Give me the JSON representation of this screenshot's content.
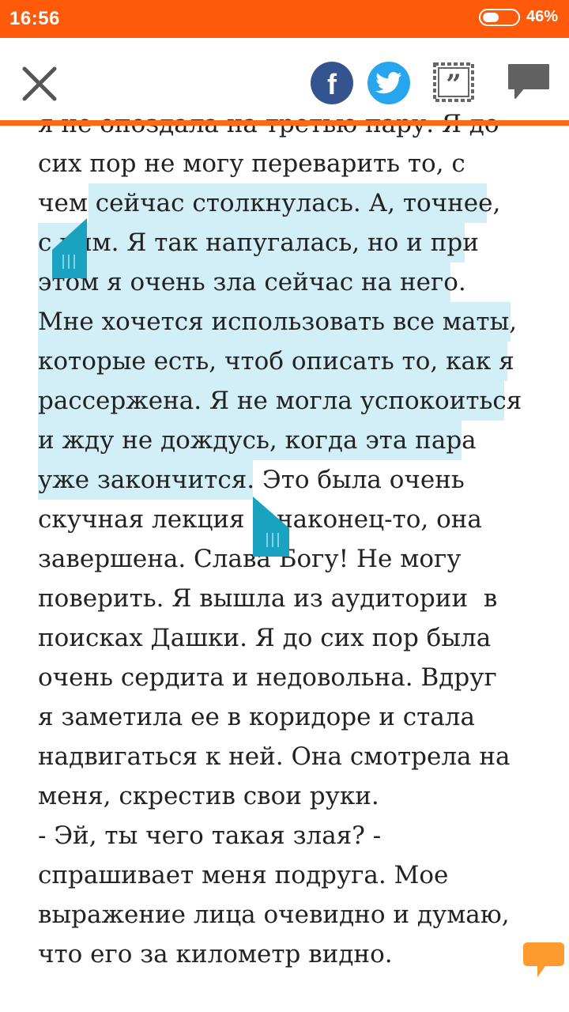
{
  "status_bar": {
    "time": "16:56",
    "battery": "46%"
  },
  "toolbar": {
    "close_icon": "close-icon",
    "facebook_icon": "facebook-icon",
    "facebook_glyph": "f",
    "twitter_icon": "twitter-icon",
    "quote_icon": "quote-icon",
    "comment_icon": "comment-icon"
  },
  "colors": {
    "accent": "#ff5a0a",
    "selection": "#d2eff7",
    "handle": "#1aa3c0",
    "facebook": "#34548f",
    "twitter": "#27a6ef",
    "text": "#222222"
  },
  "reader": {
    "lines": [
      "я не опоздала на третью пару. Я до",
      "сих пор не могу переварить то, с",
      "чем сейчас столкнулась. А, точнее,",
      "с ним. Я так напугалась, но и при",
      "этом я очень зла сейчас на него.",
      "Мне хочется использовать все маты,",
      "которые есть, чтоб описать то, как я",
      "рассержена. Я не могла успокоиться",
      "и жду не дождусь, когда эта пара",
      "уже закончится. Это была очень",
      "скучная лекция и наконец-то, она",
      "завершена. Слава Богу! Не могу",
      "поверить. Я вышла из аудитории  в",
      "поисках Дашки. Я до сих пор была",
      "очень сердита и недовольна. Вдруг",
      "я заметила ее в коридоре и стала",
      "надвигаться к ней. Она смотрела на",
      "меня, скрестив свои руки.",
      "- Эй, ты чего такая злая? -",
      "спрашивает меня подруга. Мое",
      "выражение лица очевидно и думаю,",
      "что его за километр видно."
    ]
  },
  "fab": {
    "icon": "chat-bubble-icon"
  }
}
